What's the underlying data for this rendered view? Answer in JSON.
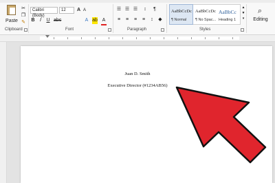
{
  "ribbon": {
    "clipboard": {
      "paste_label": "Paste",
      "group_label": "Clipboard"
    },
    "font": {
      "font_name": "Calibri (Body)",
      "font_size": "12",
      "group_label": "Font",
      "bold": "B",
      "italic": "I",
      "underline": "U",
      "text_effects": "A",
      "font_color": "A"
    },
    "paragraph": {
      "group_label": "Paragraph"
    },
    "styles": {
      "group_label": "Styles",
      "items": [
        {
          "preview": "AaBbCcDc",
          "name": "¶ Normal"
        },
        {
          "preview": "AaBbCcDc",
          "name": "¶ No Spac..."
        },
        {
          "preview": "AaBbCc",
          "name": "Heading 1"
        }
      ]
    },
    "editing": {
      "label": "Editing"
    }
  },
  "document": {
    "lines": [
      "Juan D. Smith",
      "Executive Director (#1234AB56)"
    ]
  },
  "colors": {
    "arrow": "#e0252d",
    "arrow_outline": "#111111"
  }
}
